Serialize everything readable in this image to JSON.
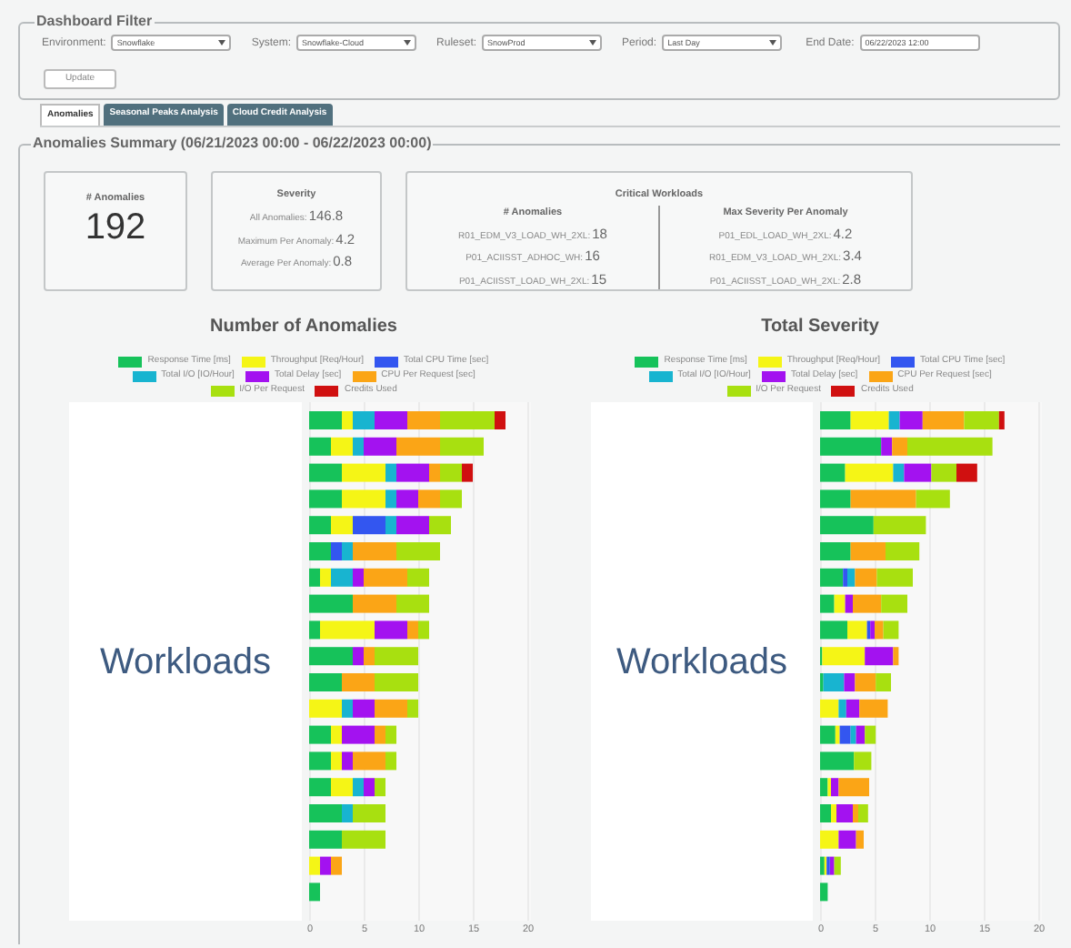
{
  "filter": {
    "title": "Dashboard Filter",
    "fields": [
      {
        "label": "Environment:",
        "value": "Snowflake",
        "kind": "select"
      },
      {
        "label": "System:",
        "value": "Snowflake-Cloud",
        "kind": "select"
      },
      {
        "label": "Ruleset:",
        "value": "SnowProd",
        "kind": "select"
      },
      {
        "label": "Period:",
        "value": "Last Day",
        "kind": "select"
      },
      {
        "label": "End Date:",
        "value": "06/22/2023 12:00",
        "kind": "text"
      }
    ],
    "update_button": "Update"
  },
  "tabs": [
    {
      "label": "Anomalies",
      "selected": true
    },
    {
      "label": "Seasonal Peaks Analysis",
      "selected": false
    },
    {
      "label": "Cloud Credit Analysis",
      "selected": false
    }
  ],
  "summary": {
    "title": "Anomalies Summary (06/21/2023 00:00 - 06/22/2023 00:00)",
    "count_card": {
      "title": "# Anomalies",
      "value": "192"
    },
    "severity_card": {
      "title": "Severity",
      "rows": [
        {
          "label": "All Anomalies:",
          "value": "146.8"
        },
        {
          "label": "Maximum Per Anomaly:",
          "value": "4.2"
        },
        {
          "label": "Average Per Anomaly:",
          "value": "0.8"
        }
      ]
    },
    "critical_card": {
      "title": "Critical Workloads",
      "columns": [
        {
          "title": "# Anomalies",
          "rows": [
            {
              "label": "R01_EDM_V3_LOAD_WH_2XL:",
              "value": "18"
            },
            {
              "label": "P01_ACIISST_ADHOC_WH:",
              "value": "16"
            },
            {
              "label": "P01_ACIISST_LOAD_WH_2XL:",
              "value": "15"
            }
          ]
        },
        {
          "title": "Max Severity Per Anomaly",
          "rows": [
            {
              "label": "P01_EDL_LOAD_WH_2XL:",
              "value": "4.2"
            },
            {
              "label": "R01_EDM_V3_LOAD_WH_2XL:",
              "value": "3.4"
            },
            {
              "label": "P01_ACIISST_LOAD_WH_2XL:",
              "value": "2.8"
            }
          ]
        }
      ]
    },
    "charts": [
      {
        "chart_data": {
          "type": "bar",
          "orientation": "horizontal",
          "stacked": true,
          "title": "Number of Anomalies",
          "ylabel": "Workloads",
          "xlim": [
            0,
            20
          ],
          "xticks": [
            0,
            5,
            10,
            15,
            20
          ],
          "grid": true,
          "legend": true,
          "series": [
            {
              "name": "Response Time [ms]",
              "color": "#16c25a",
              "values": [
                3,
                2,
                3,
                3,
                2,
                2,
                1,
                4,
                1,
                4,
                3,
                0,
                2,
                2,
                2,
                3,
                3,
                0,
                1
              ]
            },
            {
              "name": "Throughput [Req/Hour]",
              "color": "#f5f516",
              "values": [
                1,
                2,
                4,
                4,
                2,
                0,
                1,
                0,
                5,
                0,
                0,
                3,
                1,
                1,
                2,
                0,
                0,
                1,
                0
              ]
            },
            {
              "name": "Total CPU Time [sec]",
              "color": "#3356f0",
              "values": [
                0,
                0,
                0,
                0,
                3,
                1,
                0,
                0,
                0,
                0,
                0,
                0,
                0,
                0,
                0,
                0,
                0,
                0,
                0
              ]
            },
            {
              "name": "Total I/O [IO/Hour]",
              "color": "#18b4d0",
              "values": [
                2,
                1,
                1,
                1,
                1,
                1,
                2,
                0,
                0,
                0,
                0,
                1,
                0,
                0,
                1,
                1,
                0,
                0,
                0
              ]
            },
            {
              "name": "Total Delay [sec]",
              "color": "#a312f0",
              "values": [
                3,
                3,
                3,
                2,
                3,
                0,
                1,
                0,
                3,
                1,
                0,
                2,
                3,
                1,
                1,
                0,
                0,
                1,
                0
              ]
            },
            {
              "name": "CPU Per Request [sec]",
              "color": "#fba516",
              "values": [
                3,
                4,
                1,
                2,
                0,
                4,
                4,
                4,
                1,
                1,
                3,
                3,
                1,
                3,
                0,
                0,
                0,
                1,
                0
              ]
            },
            {
              "name": "I/O Per Request",
              "color": "#a8e010",
              "values": [
                5,
                4,
                2,
                2,
                2,
                4,
                2,
                3,
                1,
                4,
                4,
                1,
                1,
                1,
                1,
                3,
                4,
                0,
                0
              ]
            },
            {
              "name": "Credits Used",
              "color": "#d01010",
              "values": [
                1,
                0,
                1,
                0,
                0,
                0,
                0,
                0,
                0,
                0,
                0,
                0,
                0,
                0,
                0,
                0,
                0,
                0,
                0
              ]
            }
          ]
        }
      },
      {
        "chart_data": {
          "type": "bar",
          "orientation": "horizontal",
          "stacked": true,
          "title": "Total Severity",
          "ylabel": "Workloads",
          "xlim": [
            0,
            20
          ],
          "xticks": [
            0,
            5,
            10,
            15,
            20
          ],
          "grid": true,
          "legend": true,
          "series": [
            {
              "name": "Response Time [ms]",
              "color": "#16c25a",
              "values": [
                2.8,
                5.6,
                2.3,
                2.8,
                4.9,
                2.8,
                2.1,
                1.3,
                2.5,
                0.2,
                0.3,
                0,
                1.4,
                3.1,
                0.7,
                1,
                0,
                0.4,
                0.7
              ]
            },
            {
              "name": "Throughput [Req/Hour]",
              "color": "#f5f516",
              "values": [
                3.5,
                0,
                4.4,
                0,
                0,
                0,
                0,
                1,
                1.8,
                3.9,
                0,
                1.7,
                0.4,
                0,
                0.3,
                0.5,
                1.7,
                0.2,
                0
              ]
            },
            {
              "name": "Total CPU Time [sec]",
              "color": "#3356f0",
              "values": [
                0,
                0,
                0,
                0,
                0,
                0,
                0.4,
                0,
                0.3,
                0,
                0,
                0,
                1,
                0,
                0,
                0,
                0,
                0.3,
                0
              ]
            },
            {
              "name": "Total I/O [IO/Hour]",
              "color": "#18b4d0",
              "values": [
                1,
                0,
                1,
                0,
                0,
                0,
                0.7,
                0,
                0,
                0,
                1.9,
                0.7,
                0.5,
                0,
                0,
                0,
                0,
                0,
                0
              ]
            },
            {
              "name": "Total Delay [sec]",
              "color": "#a312f0",
              "values": [
                2.1,
                1,
                2.5,
                0,
                0,
                0,
                0,
                0.7,
                0.4,
                2.6,
                1,
                1.2,
                0.8,
                0,
                0.7,
                1.5,
                1.6,
                0.4,
                0
              ]
            },
            {
              "name": "CPU Per Request [sec]",
              "color": "#fba516",
              "values": [
                3.8,
                1.4,
                0,
                6,
                0,
                3.2,
                2,
                2.6,
                0.8,
                0.5,
                1.9,
                2.6,
                0,
                0,
                2.8,
                0.5,
                0.7,
                0,
                0
              ]
            },
            {
              "name": "I/O Per Request",
              "color": "#a8e010",
              "values": [
                3.2,
                7.8,
                2.3,
                3.1,
                4.8,
                3.1,
                3.3,
                2.4,
                1.4,
                0,
                1.4,
                0,
                1,
                1.6,
                0,
                0.9,
                0,
                0.6,
                0
              ]
            },
            {
              "name": "Credits Used",
              "color": "#d01010",
              "values": [
                0.5,
                0,
                1.9,
                0,
                0,
                0,
                0,
                0,
                0,
                0,
                0,
                0,
                0,
                0,
                0,
                0,
                0,
                0,
                0
              ]
            }
          ]
        }
      }
    ]
  }
}
